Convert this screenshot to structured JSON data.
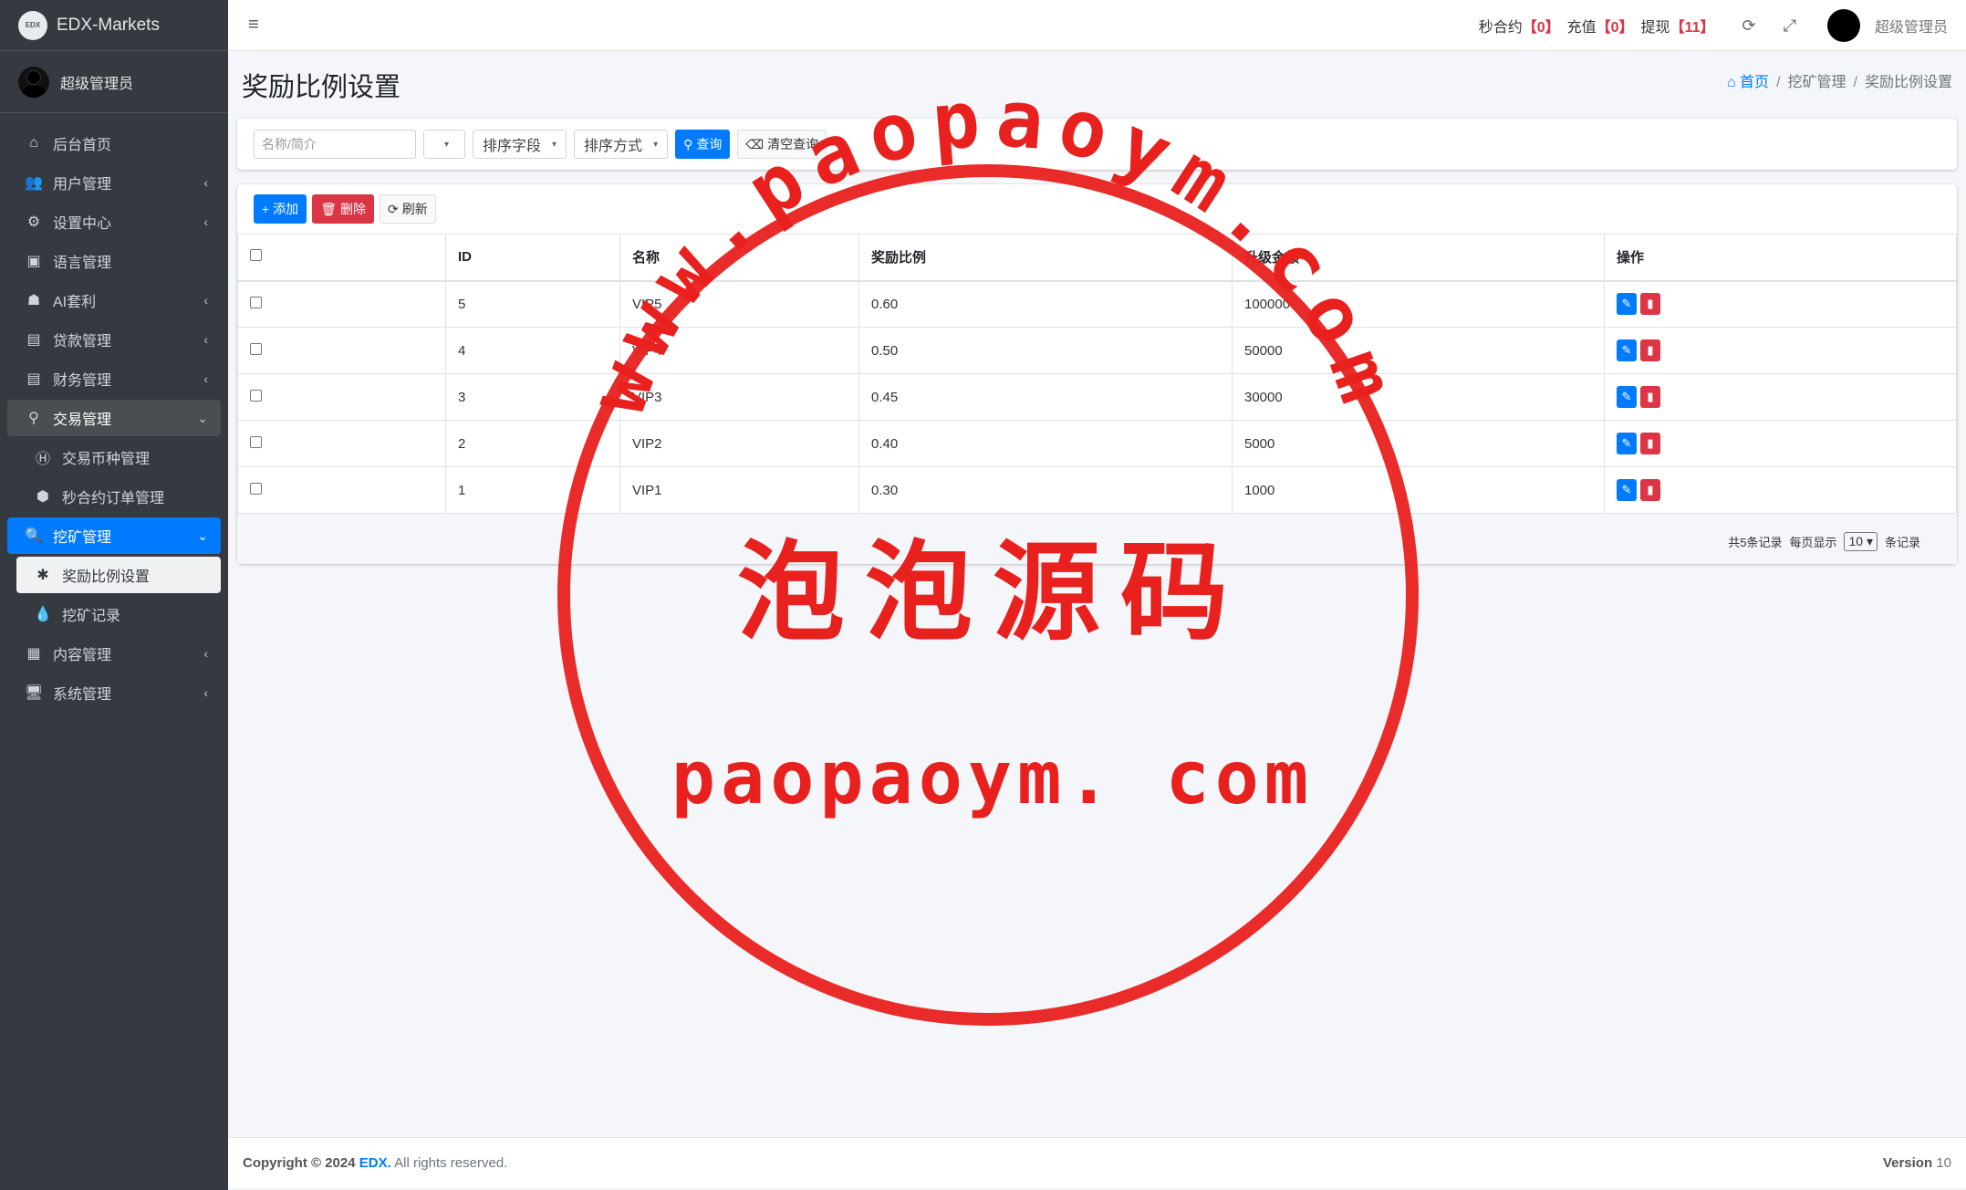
{
  "brand": {
    "logo_text": "EDX",
    "name": "EDX-Markets"
  },
  "sidebar_user": "超级管理员",
  "nav": [
    {
      "label": "后台首页",
      "icon": "home-icon",
      "glyph": "⌂",
      "chevron": ""
    },
    {
      "label": "用户管理",
      "icon": "users-icon",
      "glyph": "👥",
      "chevron": "‹"
    },
    {
      "label": "设置中心",
      "icon": "cogs-icon",
      "glyph": "⚙",
      "chevron": "‹"
    },
    {
      "label": "语言管理",
      "icon": "language-icon",
      "glyph": "▣",
      "chevron": ""
    },
    {
      "label": "AI套利",
      "icon": "android-icon",
      "glyph": "☗",
      "chevron": "‹"
    },
    {
      "label": "贷款管理",
      "icon": "money-icon",
      "glyph": "▤",
      "chevron": "‹"
    },
    {
      "label": "财务管理",
      "icon": "money-bill-icon",
      "glyph": "▤",
      "chevron": "‹"
    },
    {
      "label": "交易管理",
      "icon": "connect-icon",
      "glyph": "⚲",
      "chevron": "⌄"
    },
    {
      "label": "交易币种管理",
      "icon": "coin-icon",
      "glyph": "Ⓗ",
      "chevron": ""
    },
    {
      "label": "秒合约订单管理",
      "icon": "cube-icon",
      "glyph": "⬢",
      "chevron": ""
    },
    {
      "label": "挖矿管理",
      "icon": "search-icon",
      "glyph": "🔍",
      "chevron": "⌄"
    },
    {
      "label": "奖励比例设置",
      "icon": "bug-icon",
      "glyph": "✱",
      "chevron": ""
    },
    {
      "label": "挖矿记录",
      "icon": "drop-icon",
      "glyph": "💧",
      "chevron": ""
    },
    {
      "label": "内容管理",
      "icon": "newspaper-icon",
      "glyph": "▦",
      "chevron": "‹"
    },
    {
      "label": "系统管理",
      "icon": "desktop-icon",
      "glyph": "🖥",
      "chevron": "‹"
    }
  ],
  "topbar": {
    "hamburger": "≡",
    "s1": "秒合约",
    "n1": "【0】",
    "s2": "充值",
    "n2": "【0】",
    "s3": "提现",
    "n3": "【11】",
    "refresh": "⟳",
    "fullscreen": "⤢",
    "user": "超级管理员"
  },
  "page": {
    "title": "奖励比例设置",
    "crumb_home": "首页",
    "crumb_2": "挖矿管理",
    "crumb_3": "奖励比例设置",
    "sep": "/"
  },
  "search": {
    "name_placeholder": "名称/简介",
    "sort_field": "排序字段",
    "sort_way": "排序方式",
    "query": "查询",
    "clear": "清空查询"
  },
  "toolbar": {
    "add": "添加",
    "delete": "删除",
    "refresh": "刷新"
  },
  "table": {
    "headers": [
      "ID",
      "名称",
      "奖励比例",
      "升级金额",
      "操作"
    ],
    "rows": [
      {
        "id": "5",
        "name": "VIP5",
        "ratio": "0.60",
        "amount": "100000"
      },
      {
        "id": "4",
        "name": "VIP4",
        "ratio": "0.50",
        "amount": "50000"
      },
      {
        "id": "3",
        "name": "VIP3",
        "ratio": "0.45",
        "amount": "30000"
      },
      {
        "id": "2",
        "name": "VIP2",
        "ratio": "0.40",
        "amount": "5000"
      },
      {
        "id": "1",
        "name": "VIP1",
        "ratio": "0.30",
        "amount": "1000"
      }
    ]
  },
  "pager": {
    "total": "共5条记录",
    "per_page": "每页显示",
    "size": "10",
    "unit": "条记录"
  },
  "footer": {
    "copyright": "Copyright © 2024",
    "brand": "EDX.",
    "rights": "All rights reserved.",
    "version_label": "Version",
    "version": "10"
  },
  "watermark": {
    "arc": "www.paopaoym.com",
    "cn": "泡泡源码",
    "url": "paopaoym. com",
    "color": "#e8201e"
  }
}
